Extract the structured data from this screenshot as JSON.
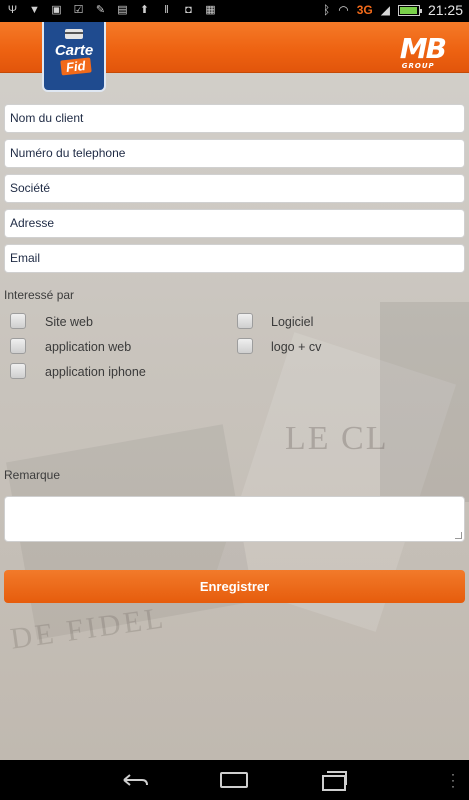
{
  "status_bar": {
    "network": "3G",
    "time": "21:25",
    "icons": [
      "usb-icon",
      "wifi-drop-icon",
      "sd-icon",
      "checkmark-icon",
      "wrench-icon",
      "picture-icon",
      "upload-icon",
      "barcode-icon",
      "shopping-bag-icon",
      "calendar-icon",
      "bluetooth-icon",
      "wifi-icon",
      "signal-icon",
      "battery-icon"
    ]
  },
  "header": {
    "logo_left_top": "Carte",
    "logo_left_bottom": "Fid",
    "logo_right": "MB",
    "logo_right_sub": "GROUP"
  },
  "form": {
    "fields": [
      {
        "placeholder": "Nom du client"
      },
      {
        "placeholder": "Numéro du telephone"
      },
      {
        "placeholder": "Société"
      },
      {
        "placeholder": "Adresse"
      },
      {
        "placeholder": "Email"
      }
    ],
    "interest_label": "Interessé par",
    "checkboxes_left": [
      {
        "label": "Site web"
      },
      {
        "label": "application web"
      },
      {
        "label": "application iphone"
      }
    ],
    "checkboxes_right": [
      {
        "label": "Logiciel"
      },
      {
        "label": "logo + cv"
      }
    ],
    "remarks_label": "Remarque",
    "save_label": "Enregistrer"
  },
  "background": {
    "text1": "LE CL",
    "text2": "DE FIDEL"
  },
  "colors": {
    "accent": "#ee6312",
    "logo_blue": "#1f4b8f"
  },
  "nav_bar": {
    "icons": [
      "back-icon",
      "home-icon",
      "recent-apps-icon",
      "overflow-menu-icon"
    ]
  }
}
